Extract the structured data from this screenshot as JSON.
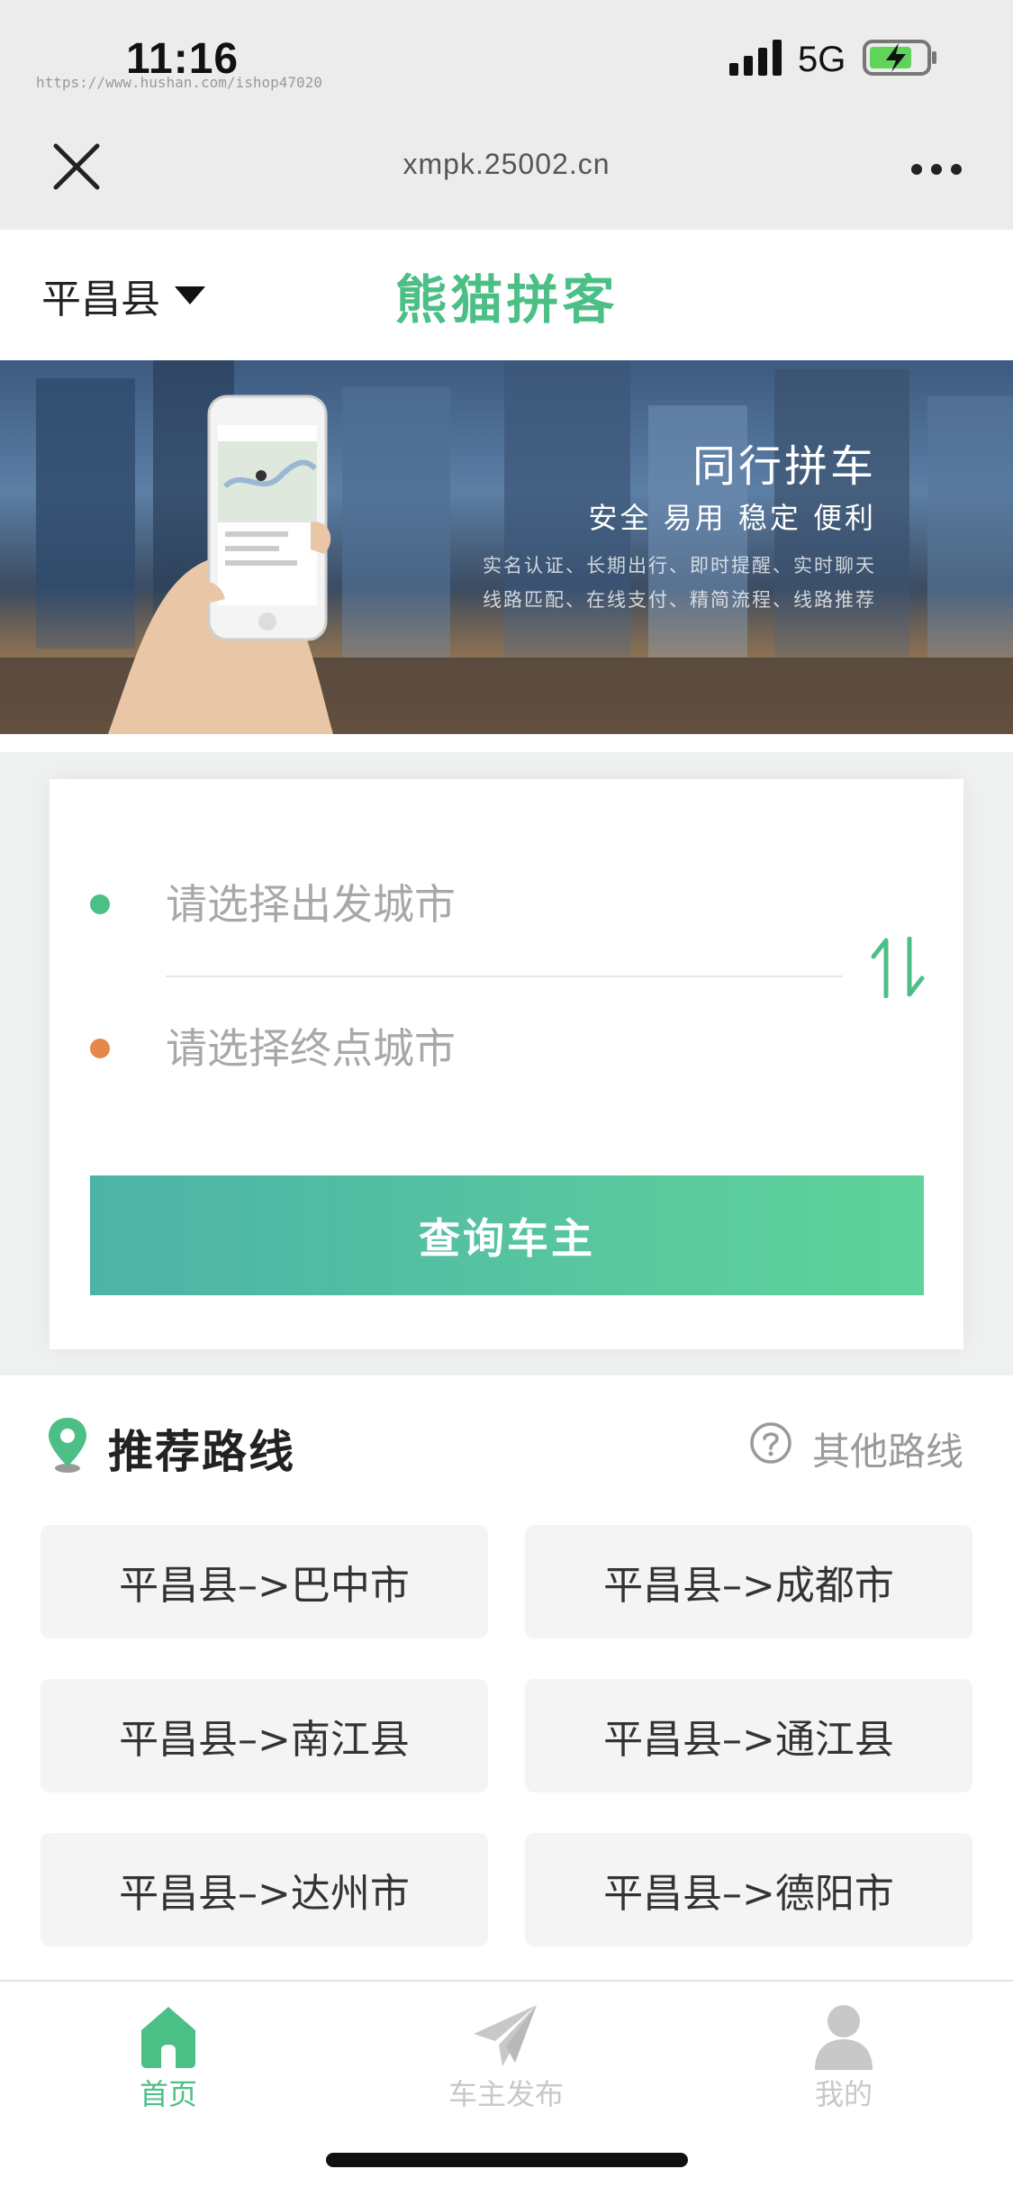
{
  "status_bar": {
    "time": "11:16",
    "watermark": "https://www.hushan.com/ishop47020",
    "network": "5G"
  },
  "browser": {
    "url": "xmpk.25002.cn"
  },
  "header": {
    "city": "平昌县",
    "title": "熊猫拼客"
  },
  "banner": {
    "headline": "同行拼车",
    "subline": "安全 易用 稳定 便利",
    "feature_line_1": "实名认证、长期出行、即时提醒、实时聊天",
    "feature_line_2": "线路匹配、在线支付、精简流程、线路推荐"
  },
  "search": {
    "from_placeholder": "请选择出发城市",
    "to_placeholder": "请选择终点城市",
    "query_button": "查询车主"
  },
  "routes": {
    "title": "推荐路线",
    "other_label": "其他路线",
    "items": [
      "平昌县–>巴中市",
      "平昌县–>成都市",
      "平昌县–>南江县",
      "平昌县–>通江县",
      "平昌县–>达州市",
      "平昌县–>德阳市"
    ]
  },
  "tabbar": {
    "items": [
      {
        "label": "首页",
        "icon": "home-icon",
        "active": true
      },
      {
        "label": "车主发布",
        "icon": "paper-plane-icon",
        "active": false
      },
      {
        "label": "我的",
        "icon": "user-icon",
        "active": false
      }
    ]
  },
  "colors": {
    "brand_green": "#4cbf86",
    "start_dot": "#4cbf86",
    "end_dot": "#e8874a",
    "inactive_tab": "#c8c8c8"
  }
}
